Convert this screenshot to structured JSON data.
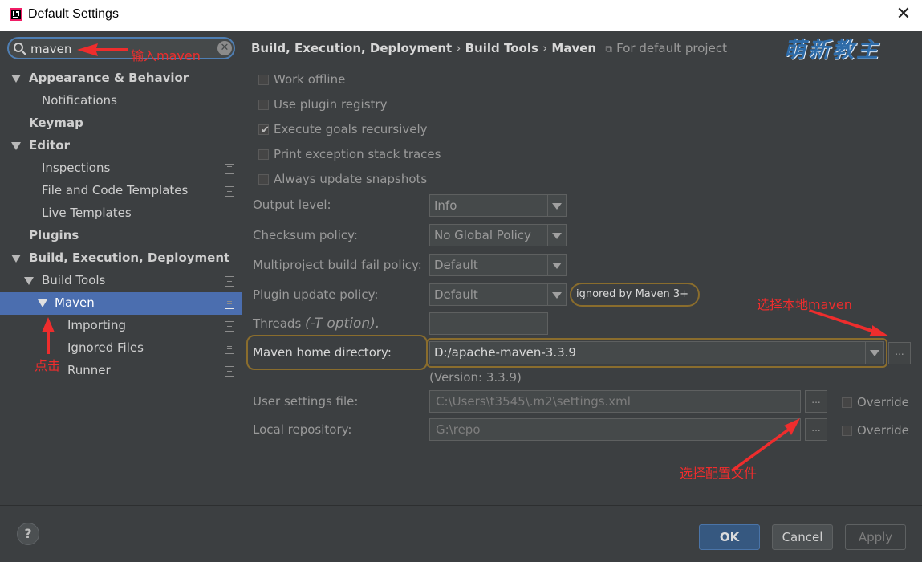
{
  "window": {
    "title": "Default Settings"
  },
  "search": {
    "value": "maven"
  },
  "tree": {
    "items": [
      {
        "label": "Appearance & Behavior"
      },
      {
        "label": "Notifications"
      },
      {
        "label": "Keymap"
      },
      {
        "label": "Editor"
      },
      {
        "label": "Inspections"
      },
      {
        "label": "File and Code Templates"
      },
      {
        "label": "Live Templates"
      },
      {
        "label": "Plugins"
      },
      {
        "label": "Build, Execution, Deployment"
      },
      {
        "label": "Build Tools"
      },
      {
        "label": "Maven"
      },
      {
        "label": "Importing"
      },
      {
        "label": "Ignored Files"
      },
      {
        "label": "Runner"
      }
    ]
  },
  "breadcrumb": {
    "part1": "Build, Execution, Deployment",
    "sep": "›",
    "part2": "Build Tools",
    "part3": "Maven",
    "project": "For default project"
  },
  "watermark": "萌新教主",
  "checkboxes": [
    {
      "label": "Work offline",
      "checked": false
    },
    {
      "label": "Use plugin registry",
      "checked": false
    },
    {
      "label": "Execute goals recursively",
      "checked": true
    },
    {
      "label": "Print exception stack traces",
      "checked": false
    },
    {
      "label": "Always update snapshots",
      "checked": false
    }
  ],
  "form": {
    "output_level": {
      "label": "Output level:",
      "value": "Info"
    },
    "checksum_policy": {
      "label": "Checksum policy:",
      "value": "No Global Policy"
    },
    "multiproject": {
      "label": "Multiproject build fail policy:",
      "value": "Default"
    },
    "plugin_update": {
      "label": "Plugin update policy:",
      "value": "Default",
      "note": "ignored by Maven 3+"
    },
    "threads": {
      "label": "Threads",
      "hint": "(-T option)."
    },
    "maven_home": {
      "label": "Maven home directory:",
      "value": "D:/apache-maven-3.3.9",
      "version": "(Version: 3.3.9)"
    },
    "user_settings": {
      "label": "User settings file:",
      "value": "C:\\Users\\t3545\\.m2\\settings.xml",
      "override": "Override"
    },
    "local_repo": {
      "label": "Local repository:",
      "value": "G:\\repo",
      "override": "Override"
    },
    "browse": "..."
  },
  "buttons": {
    "ok": "OK",
    "cancel": "Cancel",
    "apply": "Apply",
    "help": "?"
  },
  "annotations": {
    "input_maven": "输入maven",
    "click": "点击",
    "select_local_maven": "选择本地maven",
    "select_config": "选择配置文件"
  },
  "colors": {
    "accent": "#4b6eaf",
    "annotation": "#ee2d2d",
    "highlight": "#8a6d2d"
  }
}
